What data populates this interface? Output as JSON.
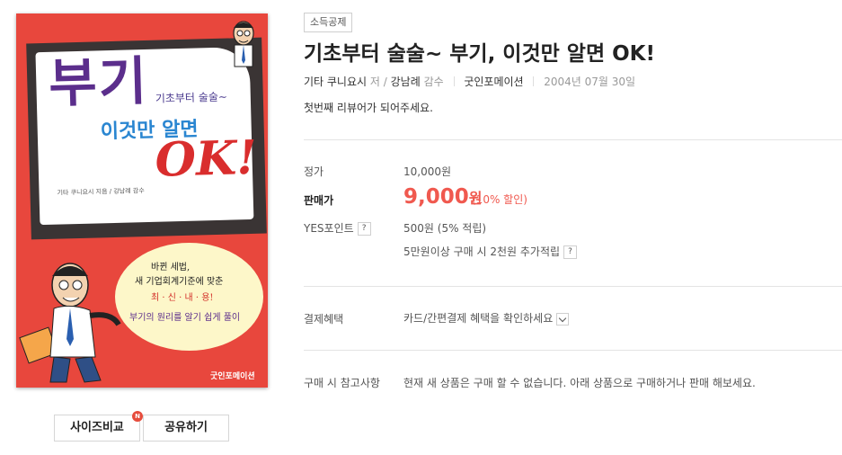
{
  "cover": {
    "title_big": "부기",
    "subtitle_small": "기초부터 술술~",
    "subtitle_blue": "이것만 알면",
    "title_ok": "OK!",
    "credit": "기타 쿠니요시 지음 / 강남례 감수",
    "bubble_lines": [
      "바뀐 세법,",
      "새 기업회계기준에 맞춘",
      "최 · 신 · 내 · 용!",
      "부기의 원리를 알기 쉽게 풀이"
    ],
    "publisher": "굿인포메이션"
  },
  "buttons": {
    "compare_label": "사이즈비교",
    "new_badge": "N",
    "share_label": "공유하기"
  },
  "product": {
    "category": "소득공제",
    "title": "기초부터 술술~ 부기, 이것만 알면 OK!",
    "author": "기타 쿠니요시",
    "author_role": "저 /",
    "supervisor": "강남례",
    "supervisor_role": "감수",
    "publisher": "굿인포메이션",
    "date": "2004년 07월 30일",
    "review_cta": "첫번째 리뷰어가 되어주세요."
  },
  "price": {
    "list_label": "정가",
    "list_value": "10,000원",
    "sale_label": "판매가",
    "sale_value": "9,000",
    "sale_unit": "원",
    "discount": "(10% 할인)",
    "points_label": "YES포인트",
    "points_value": "500원 (5% 적립)",
    "extra_points": "5만원이상 구매 시 2천원 추가적립",
    "help_mark": "?"
  },
  "payment": {
    "label": "결제혜택",
    "value": "카드/간편결제 혜택을 확인하세요"
  },
  "notice": {
    "label": "구매 시 참고사항",
    "value": "현재 새 상품은 구매 할 수 없습니다. 아래 상품으로 구매하거나 판매 해보세요."
  }
}
